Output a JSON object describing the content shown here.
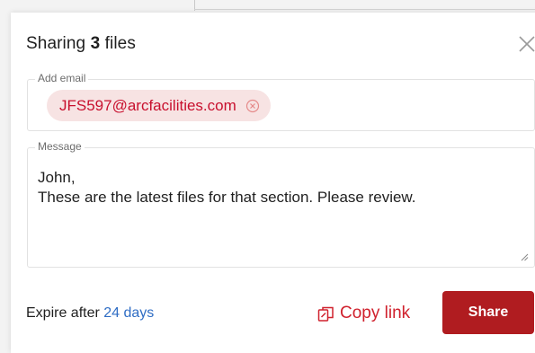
{
  "dialog": {
    "title_prefix": "Sharing",
    "file_count": "3",
    "title_suffix": "files",
    "close_icon": "close-icon"
  },
  "email": {
    "legend": "Add email",
    "recipients": [
      {
        "address": "JFS597@arcfacilities.com",
        "remove_icon": "remove-circle-icon"
      }
    ]
  },
  "message": {
    "legend": "Message",
    "value": "John,\nThese are the latest files for that section. Please review."
  },
  "footer": {
    "expire_label": "Expire after",
    "expire_value": "24 days",
    "copy_link_label": "Copy link",
    "copy_link_icon": "copy-link-icon",
    "share_label": "Share"
  },
  "colors": {
    "accent": "#b01c20",
    "chip_bg": "#f7e3e3",
    "chip_text": "#c8102e",
    "link_blue": "#2f6dc4"
  }
}
